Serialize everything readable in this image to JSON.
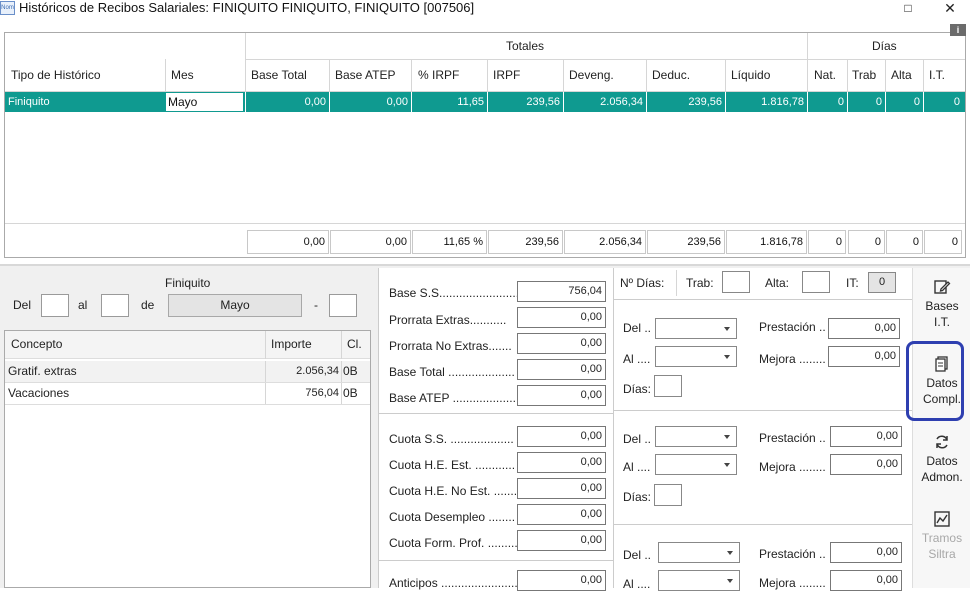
{
  "window": {
    "title": "Históricos de Recibos Salariales: FINIQUITO FINIQUITO, FINIQUITO [007506]",
    "app_icon_text": "Nom"
  },
  "grid": {
    "group_headers": {
      "totales": "Totales",
      "dias": "Días"
    },
    "columns": [
      "Tipo de Histórico",
      "Mes",
      "Base Total",
      "Base ATEP",
      "% IRPF",
      "IRPF",
      "Deveng.",
      "Deduc.",
      "Líquido",
      "Nat.",
      "Trab",
      "Alta",
      "I.T."
    ],
    "row": {
      "tipo": "Finiquito",
      "mes": "Mayo",
      "base_total": "0,00",
      "base_atep": "0,00",
      "pct_irpf": "11,65",
      "irpf": "239,56",
      "deveng": "2.056,34",
      "deduc": "239,56",
      "liquido": "1.816,78",
      "nat": "0",
      "trab": "0",
      "alta": "0",
      "it": "0"
    },
    "totals": {
      "base_total": "0,00",
      "base_atep": "0,00",
      "pct_irpf": "11,65 %",
      "irpf": "239,56",
      "deveng": "2.056,34",
      "deduc": "239,56",
      "liquido": "1.816,78",
      "nat": "0",
      "trab": "0",
      "alta": "0",
      "it": "0"
    },
    "info_mark": "i"
  },
  "finiquito": {
    "title": "Finiquito",
    "del_label": "Del",
    "al_label": "al",
    "de_label": "de",
    "dash": "-",
    "mes_value": "Mayo"
  },
  "concepts": {
    "headers": [
      "Concepto",
      "Importe",
      "Cl."
    ],
    "rows": [
      {
        "concepto": "Gratif. extras",
        "importe": "2.056,34",
        "cl": "0B"
      },
      {
        "concepto": "Vacaciones",
        "importe": "756,04",
        "cl": "0B"
      }
    ]
  },
  "bases": {
    "group1": [
      {
        "label": "Base S.S.........................",
        "value": "756,04"
      },
      {
        "label": "Prorrata Extras...........",
        "value": "0,00"
      },
      {
        "label": "Prorrata No Extras.......",
        "value": "0,00"
      },
      {
        "label": "Base Total ....................",
        "value": "0,00"
      },
      {
        "label": "Base ATEP ...................",
        "value": "0,00"
      }
    ],
    "group2": [
      {
        "label": "Cuota S.S. ...................",
        "value": "0,00"
      },
      {
        "label": "Cuota H.E. Est. ............",
        "value": "0,00"
      },
      {
        "label": "Cuota H.E. No Est. .......",
        "value": "0,00"
      },
      {
        "label": "Cuota Desempleo ........",
        "value": "0,00"
      },
      {
        "label": "Cuota Form. Prof. .........",
        "value": "0,00"
      }
    ],
    "group3": [
      {
        "label": "Anticipos .........................",
        "value": "0,00"
      }
    ]
  },
  "it": {
    "n_dias_label": "Nº Días:",
    "trab_label": "Trab:",
    "alta_label": "Alta:",
    "it_label": "IT:",
    "it_value": "0",
    "del_label": "Del ..",
    "al_label": "Al ....",
    "dias_label": "Días:",
    "prestacion_label": "Prestación ..",
    "mejora_label": "Mejora ........",
    "blocks": [
      {
        "prestacion": "0,00",
        "mejora": "0,00"
      },
      {
        "prestacion": "0,00",
        "mejora": "0,00"
      },
      {
        "prestacion": "0,00",
        "mejora": "0,00"
      }
    ]
  },
  "side_buttons": {
    "bases_it": [
      "Bases",
      "I.T."
    ],
    "datos_compl": [
      "Datos",
      "Compl."
    ],
    "datos_admon": [
      "Datos",
      "Admon."
    ],
    "tramos_siltra": [
      "Tramos",
      "Siltra"
    ]
  },
  "colors": {
    "selection": "#0f9a90",
    "highlight_outline": "#2e3fb0"
  }
}
